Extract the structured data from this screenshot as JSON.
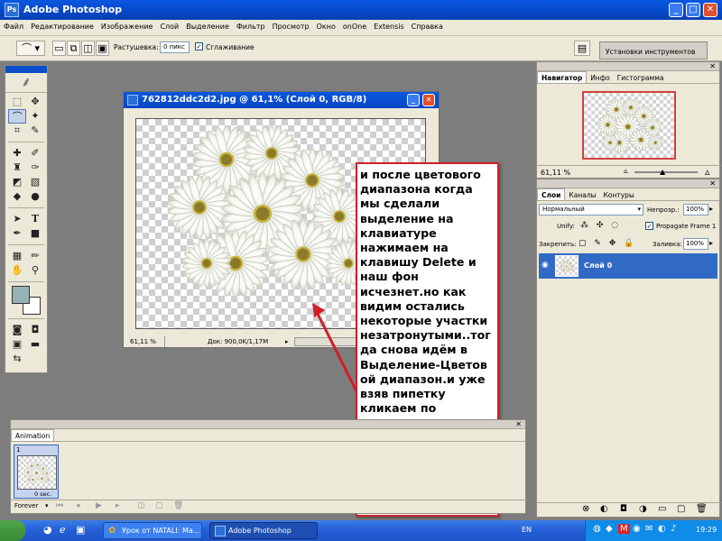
{
  "window": {
    "title": "Adobe Photoshop",
    "logo": "Ps"
  },
  "menu": [
    "Файл",
    "Редактирование",
    "Изображение",
    "Слой",
    "Выделение",
    "Фильтр",
    "Просмотр",
    "Окно",
    "onOne",
    "Extensis",
    "Справка"
  ],
  "options_bar": {
    "feather_label": "Растушевка:",
    "feather_value": "0 пикс",
    "antialias_label": "Сглаживание",
    "presets_label": "Установки инструментов"
  },
  "document": {
    "title": "762812ddc2d2.jpg @ 61,1% (Слой 0, RGB/8)",
    "zoom": "61,11 %",
    "doc_info": "Док: 900,0K/1,17M"
  },
  "annotation": {
    "text": "и после цветового\nдиапазона когда\nмы сделали\nвыделение на\nклавиатуре\nнажимаем на\nклавишу  Delete  и\nнаш фон\nисчезнет.но как\nвидим остались\nнекоторые участки\nнезатронутыми..тог\nда снова идём в\nВыделение-Цветов\nой диапазон.и уже\nвзяв пипетку\nкликаем по\nнетронутым\nучасткам  делаем\nвыделение и\nнажимаем снова\nDelete"
  },
  "navigator": {
    "tabs": [
      "Навигатор",
      "Инфо",
      "Гистограмма"
    ],
    "zoom": "61,11 %"
  },
  "layers": {
    "tabs": [
      "Слои",
      "Каналы",
      "Контуры"
    ],
    "blend_mode": "Нормальный",
    "opacity_label": "Непрозр.:",
    "opacity_value": "100%",
    "unify_label": "Unify:",
    "propagate_label": "Propagate Frame 1",
    "lock_label": "Закрепить:",
    "fill_label": "Заливка:",
    "fill_value": "100%",
    "layer_name": "Слой 0"
  },
  "animation": {
    "tab": "Animation",
    "frame_number": "1",
    "frame_delay": "0 sec.",
    "loop": "Forever"
  },
  "taskbar": {
    "task1": "Урок от NATALI: Ма...",
    "task2": "Adobe Photoshop",
    "lang": "EN",
    "clock": "19:29"
  },
  "colors": {
    "foreground": "#97b2b4",
    "background": "#ffffff",
    "annotation_border": "#c9222a",
    "layer_selected": "#316ac5"
  }
}
